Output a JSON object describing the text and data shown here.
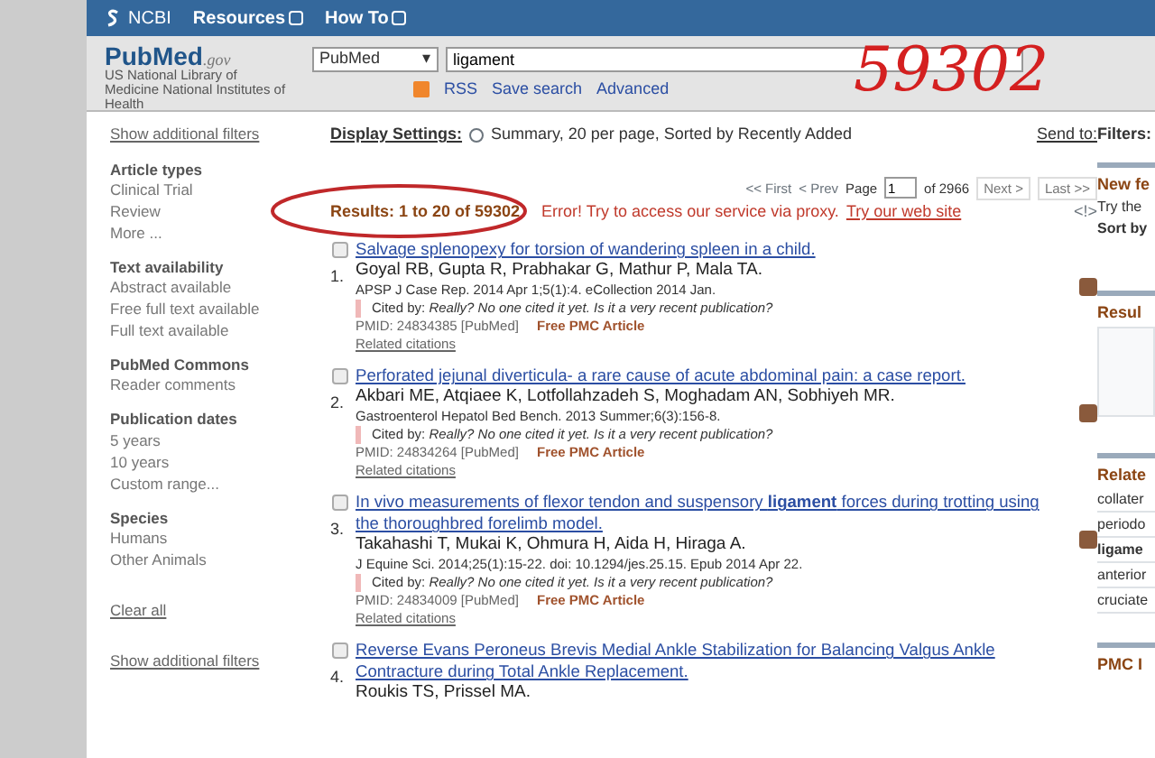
{
  "header": {
    "brand": "NCBI",
    "menus": [
      "Resources",
      "How To"
    ]
  },
  "logo": {
    "title_a": "Pub",
    "title_b": "Med",
    "suffix": ".gov",
    "org": "US National Library of Medicine National Institutes of Health"
  },
  "search": {
    "database": "PubMed",
    "caret": "▾",
    "query": "ligament",
    "links": [
      "RSS",
      "Save search",
      "Advanced"
    ]
  },
  "sidebar": {
    "show_filters_top": "Show additional filters",
    "groups": [
      {
        "title": "Article types",
        "items": [
          "Clinical Trial",
          "Review",
          "More ..."
        ]
      },
      {
        "title": "Text availability",
        "items": [
          "Abstract available",
          "Free full text available",
          "Full text available"
        ]
      },
      {
        "title": "PubMed Commons",
        "items": [
          "Reader comments"
        ]
      },
      {
        "title": "Publication dates",
        "items": [
          "5 years",
          "10 years",
          "Custom range..."
        ]
      },
      {
        "title": "Species",
        "items": [
          "Humans",
          "Other Animals"
        ]
      }
    ],
    "clear": "Clear all",
    "show_filters_bottom": "Show additional filters"
  },
  "display": {
    "label": "Display Settings:",
    "summary": "Summary, 20 per page, Sorted by Recently Added",
    "send_to": "Send to:"
  },
  "pager": {
    "first": "<< First",
    "prev": "< Prev",
    "page_label": "Page",
    "page": "1",
    "of": "of 2966",
    "next": "Next >",
    "last": "Last >>"
  },
  "results_count": "Results: 1 to 20 of 59302",
  "error": "Error! Try to access our service via proxy.",
  "error_link": "Try our web site",
  "help": "<!>",
  "results": [
    {
      "number": "1.",
      "checked": false,
      "title": "Salvage splenopexy for torsion of wandering spleen in a child.",
      "authors": "Goyal RB, Gupta R, Prabhakar G, Mathur P, Mala TA.",
      "journal": "APSP J Case Rep. 2014 Apr 1;5(1):4. eCollection 2014 Jan.",
      "cited": "Cited by: *Really? No one cited it yet. Is it a very recent publication?*",
      "pmid": "PMID: 24834385 [PubMed]",
      "free": "Free PMC Article",
      "related": "Related citations"
    },
    {
      "number": "2.",
      "checked": false,
      "title": "Perforated jejunal diverticula- a rare cause of acute abdominal pain: a case report.",
      "authors": "Akbari ME, Atqiaee K, Lotfollahzadeh S, Moghadam AN, Sobhiyeh MR.",
      "journal": "Gastroenterol Hepatol Bed Bench. 2013 Summer;6(3):156-8.",
      "cited": "Cited by: *Really? No one cited it yet. Is it a very recent publication?*",
      "pmid": "PMID: 24834264 [PubMed]",
      "free": "Free PMC Article",
      "related": "Related citations"
    },
    {
      "number": "3.",
      "checked": false,
      "title": "In vivo measurements of flexor tendon and suspensory **ligament** forces during trotting using the thoroughbred forelimb model.",
      "authors": "Takahashi T, Mukai K, Ohmura H, Aida H, Hiraga A.",
      "journal": "J Equine Sci. 2014;25(1):15-22. doi: 10.1294/jes.25.15. Epub 2014 Apr 22.",
      "cited": "Cited by: *Really? No one cited it yet. Is it a very recent publication?*",
      "pmid": "PMID: 24834009 [PubMed]",
      "free": "Free PMC Article",
      "related": "Related citations"
    },
    {
      "number": "4.",
      "checked": false,
      "title": "Reverse Evans Peroneus Brevis Medial Ankle Stabilization for Balancing Valgus Ankle Contracture during Total Ankle Replacement.",
      "authors": "Roukis TS, Prissel MA."
    }
  ],
  "right_panel": {
    "filters": "Filters:",
    "new_feature": "New fe",
    "new_feature_text": [
      "Try the",
      "Sort by"
    ],
    "results_by_year": "Resul",
    "related": "Relate",
    "related_terms": [
      {
        "text": "collater",
        "bold": false
      },
      {
        "text": "periodo",
        "bold": false
      },
      {
        "text": "ligame",
        "bold": true
      },
      {
        "text": "anterior",
        "bold": false
      },
      {
        "text": "cruciate",
        "bold": false
      }
    ],
    "pmc": "PMC I"
  },
  "annotation": {
    "handwritten": "59302"
  }
}
